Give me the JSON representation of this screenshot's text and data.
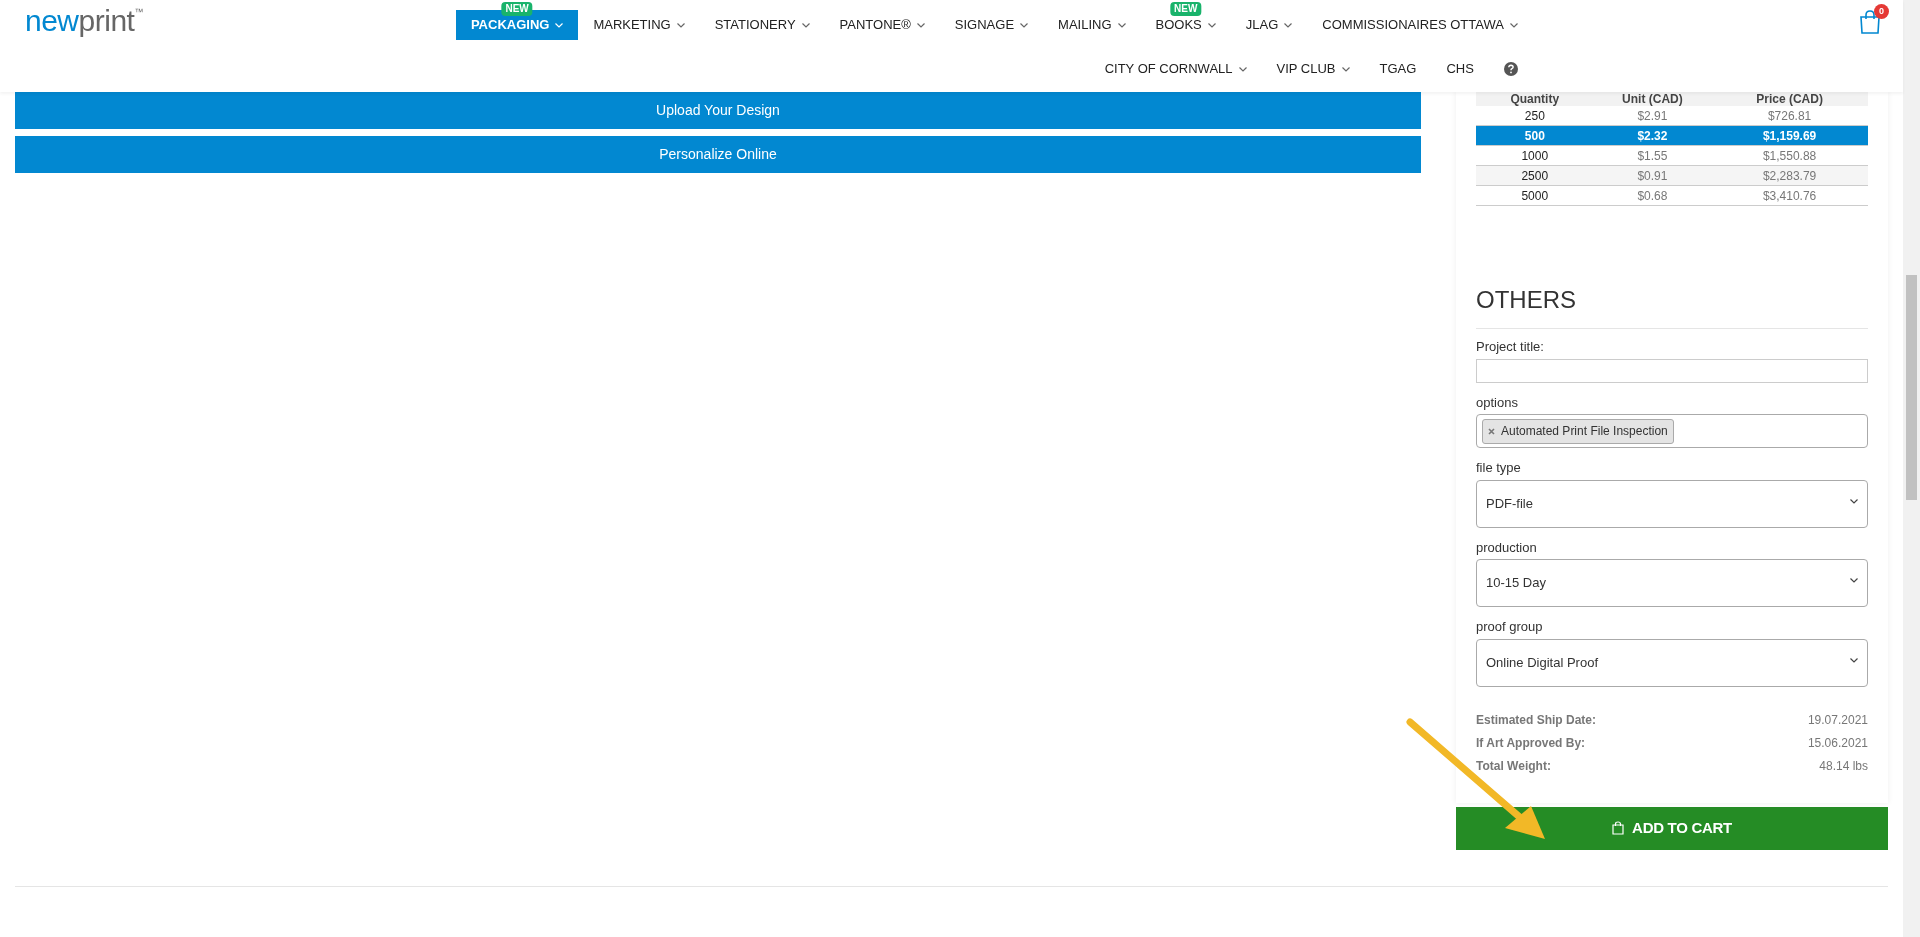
{
  "header": {
    "logo": {
      "word_a": "new",
      "word_b": "print",
      "mark": "™"
    },
    "nav_rows": [
      [
        {
          "label": "PACKAGING",
          "selected": true,
          "dropdown": true,
          "badge": "NEW"
        },
        {
          "label": "MARKETING",
          "selected": false,
          "dropdown": true
        },
        {
          "label": "STATIONERY",
          "selected": false,
          "dropdown": true
        },
        {
          "label": "PANTONE®",
          "selected": false,
          "dropdown": true
        },
        {
          "label": "SIGNAGE",
          "selected": false,
          "dropdown": true
        },
        {
          "label": "MAILING",
          "selected": false,
          "dropdown": true
        },
        {
          "label": "BOOKS",
          "selected": false,
          "dropdown": true,
          "badge": "NEW"
        },
        {
          "label": "JLAG",
          "selected": false,
          "dropdown": true
        },
        {
          "label": "COMMISSIONAIRES OTTAWA",
          "selected": false,
          "dropdown": true
        }
      ],
      [
        {
          "label": "CITY OF CORNWALL",
          "selected": false,
          "dropdown": true
        },
        {
          "label": "VIP CLUB",
          "selected": false,
          "dropdown": true
        },
        {
          "label": "TGAG",
          "selected": false,
          "dropdown": false
        },
        {
          "label": "CHS",
          "selected": false,
          "dropdown": false
        }
      ]
    ],
    "cart_count": "0"
  },
  "design_buttons": [
    "Upload Your Design",
    "Personalize Online"
  ],
  "price_table": {
    "columns": [
      "Quantity",
      "Unit (CAD)",
      "Price (CAD)"
    ],
    "rows": [
      {
        "cells": [
          "250",
          "$2.91",
          "$726.81"
        ],
        "selected": false
      },
      {
        "cells": [
          "500",
          "$2.32",
          "$1,159.69"
        ],
        "selected": true
      },
      {
        "cells": [
          "1000",
          "$1.55",
          "$1,550.88"
        ],
        "selected": false
      },
      {
        "cells": [
          "2500",
          "$0.91",
          "$2,283.79"
        ],
        "selected": false
      },
      {
        "cells": [
          "5000",
          "$0.68",
          "$3,410.76"
        ],
        "selected": false
      }
    ]
  },
  "others": {
    "title": "OTHERS",
    "fields": [
      {
        "kind": "text",
        "label": "Project title:"
      },
      {
        "kind": "tags",
        "label": "options",
        "tags": [
          "Automated Print File Inspection"
        ]
      },
      {
        "kind": "select",
        "label": "file type",
        "value": "PDF-file"
      },
      {
        "kind": "select",
        "label": "production",
        "value": "10-15 Day"
      },
      {
        "kind": "select",
        "label": "proof group",
        "value": "Online Digital Proof"
      }
    ],
    "summary": [
      {
        "label": "Estimated Ship Date:",
        "value": "19.07.2021"
      },
      {
        "label": "If Art Approved By:",
        "value": "15.06.2021"
      },
      {
        "label": "Total Weight:",
        "value": "48.14 lbs"
      }
    ]
  },
  "add_to_cart": "ADD TO CART"
}
